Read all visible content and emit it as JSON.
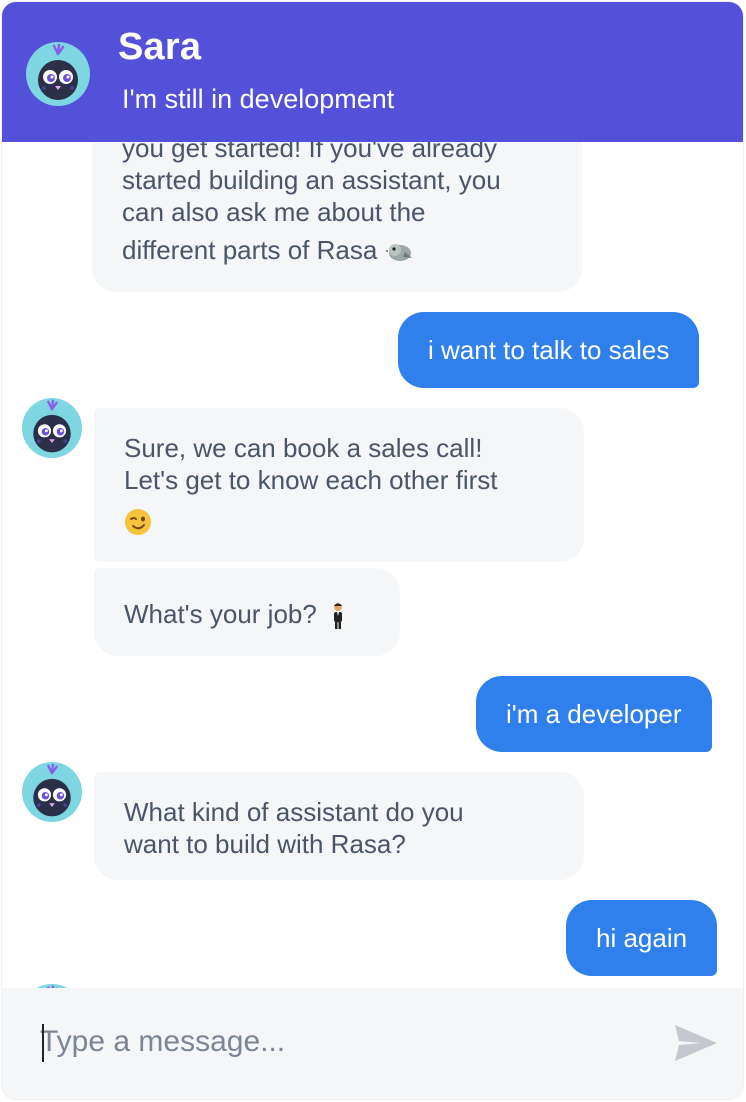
{
  "header": {
    "title": "Sara",
    "subtitle": "I'm still in development",
    "background_color": "#5351d9"
  },
  "messages": [
    {
      "sender": "bot",
      "lines": [
        "you get started! If you've already",
        "started building an assistant, you",
        "can also ask me about the",
        "different parts of Rasa"
      ],
      "emoji": "bird"
    },
    {
      "sender": "user",
      "text": "i want to talk to sales"
    },
    {
      "sender": "bot",
      "lines": [
        "Sure, we can book a sales call!",
        "Let's get to know each other first"
      ],
      "emoji": "winking-face"
    },
    {
      "sender": "bot",
      "lines": [
        "What's your job?"
      ],
      "emoji": "person-in-suit"
    },
    {
      "sender": "user",
      "text": "i'm a developer"
    },
    {
      "sender": "bot",
      "lines": [
        "What kind of assistant do you",
        "want to build with Rasa?"
      ]
    },
    {
      "sender": "user",
      "text": "hi again"
    }
  ],
  "input": {
    "placeholder": "Type a message...",
    "value": ""
  },
  "icons": {
    "avatar": "owl-bot-avatar-icon",
    "send": "send-icon"
  },
  "colors": {
    "user_bubble": "#2f80ed",
    "bot_bubble": "#f4f6f8",
    "bot_text": "#4a5568"
  }
}
